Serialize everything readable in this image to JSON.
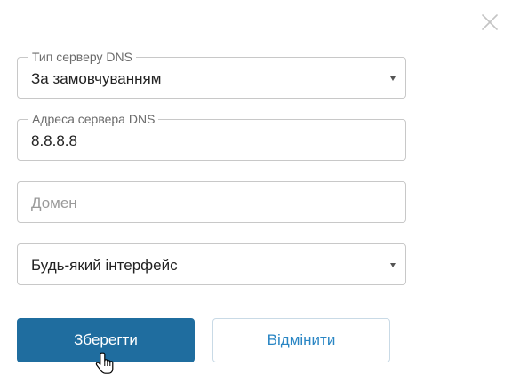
{
  "dns_type": {
    "label": "Тип серверу DNS",
    "value": "За замовчуванням"
  },
  "dns_address": {
    "label": "Адреса сервера DNS",
    "value": "8.8.8.8"
  },
  "domain": {
    "placeholder": "Домен"
  },
  "interface": {
    "value": "Будь-який інтерфейс"
  },
  "buttons": {
    "save": "Зберегти",
    "cancel": "Відмінити"
  },
  "icons": {
    "close": "close-icon",
    "dropdown": "chevron-down-icon",
    "cursor": "hand-pointer-icon"
  },
  "colors": {
    "primary": "#1f6d9f",
    "link": "#2a86c4",
    "border": "#c8c8c8"
  }
}
